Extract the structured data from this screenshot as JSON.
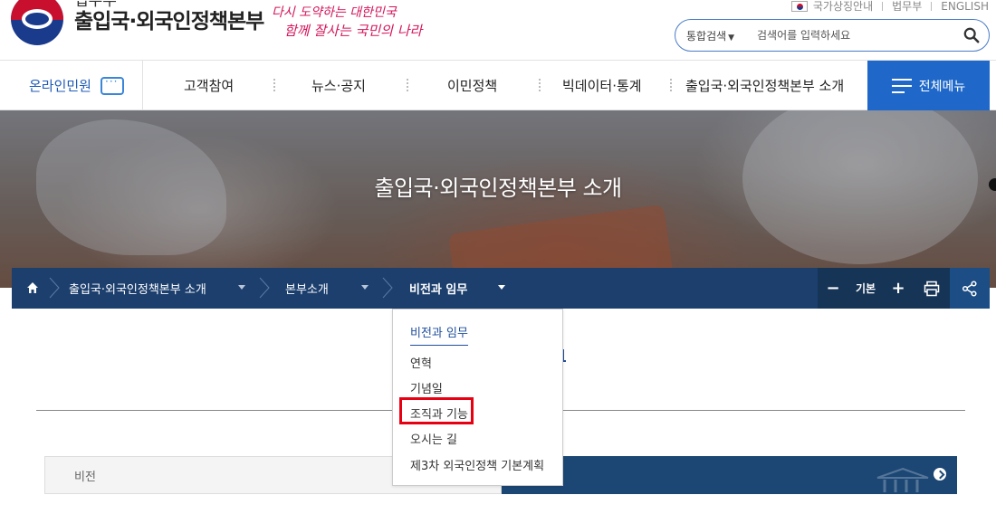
{
  "header": {
    "ministry": "법무부",
    "org_name": "출입국·외국인정책본부",
    "slogan_line1": "다시 도약하는 대한민국",
    "slogan_line2": "함께 잘사는 국민의 나라",
    "util_links": [
      "국가상징안내",
      "법무부",
      "ENGLISH"
    ],
    "search": {
      "category": "통합검색",
      "placeholder": "검색어를 입력하세요"
    }
  },
  "gnb": {
    "online_label": "온라인민원",
    "menus": [
      "고객참여",
      "뉴스·공지",
      "이민정책",
      "빅데이터·통계",
      "출입국·외국인정책본부 소개"
    ],
    "all_menu": "전체메뉴"
  },
  "banner": {
    "title": "출입국·외국인정책본부 소개"
  },
  "breadcrumb": {
    "items": [
      "출입국·외국인정책본부 소개",
      "본부소개",
      "비전과 임무"
    ],
    "font_size_label": "기본",
    "minus": "−",
    "plus": "+"
  },
  "dropdown": {
    "items": [
      "비전과 임무",
      "연혁",
      "기념일",
      "조직과 기능",
      "오시는 길",
      "제3차 외국인정책 기본계획"
    ],
    "current": "비전과 임무",
    "highlighted": "조직과 기능"
  },
  "tabs": {
    "vision": "비전"
  },
  "colors": {
    "primary_blue": "#1f68c9",
    "breadcrumb_bg": "#1c3f6e",
    "highlight_red": "#e60012"
  }
}
